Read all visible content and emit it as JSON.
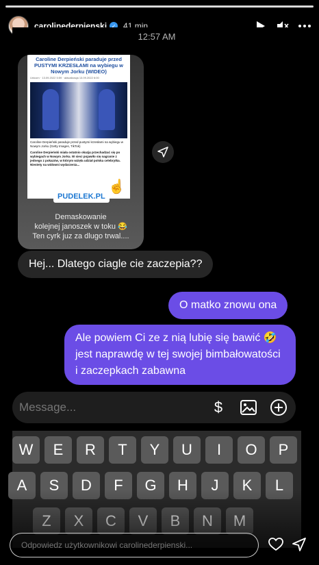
{
  "story": {
    "username": "carolinederpienski",
    "time_ago": "41 min",
    "reply_placeholder": "Odpowiedz użytkownikowi carolinederpienski..."
  },
  "chat": {
    "timestamp": "12:57 AM",
    "shared_post": {
      "title": "Caroline Derpieński paraduje przed PUSTYMI KRZESŁAMI na wybiegu w Nowym Jorku (WIDEO)",
      "meta": "Unicorn · 13.09.2022 5:59 · aktualizacja 13.09.2022 6:00",
      "photo_caption": "Caroline Derpieński paraduje przed pustymi krzesłami na wybiegu w Nowym Jorku (Getty Images, TikTok)",
      "body": "Caroline Derpieński miała ostatnio okazję przechadzać się po wybiegach w Nowym Jorku. W sieci pojawiło się nagranie z jednego z pokazów, w którym wzięła udział polska celebrytka. Niestety na widowni wydarzenia...",
      "logo": "PUDELEK.PL",
      "caption_line1": "Demaskowanie",
      "caption_line2": "kolejnej janoszek w toku 😂",
      "caption_line3": "Ten cyrk juz za dlugo trwal...."
    },
    "messages": [
      {
        "direction": "incoming",
        "text": "Hej... Dlatego ciagle cie zaczepia??"
      },
      {
        "direction": "outgoing",
        "text": "O matko znowu ona"
      },
      {
        "direction": "outgoing",
        "text": "Ale powiem Ci ze z nią lubię się bawić 🤣 jest naprawdę w tej swojej bimbałowatości i zaczepkach zabawna"
      }
    ],
    "composer_placeholder": "Message..."
  },
  "keyboard": {
    "row1": [
      "W",
      "E",
      "R",
      "T",
      "Y",
      "U",
      "I",
      "O",
      "P"
    ],
    "row2": [
      "A",
      "S",
      "D",
      "F",
      "G",
      "H",
      "J",
      "K",
      "L"
    ],
    "row3": [
      "Z",
      "X",
      "C",
      "V",
      "B",
      "N",
      "M"
    ]
  },
  "colors": {
    "outgoing_bubble": "#6b4de6",
    "incoming_bubble": "#262626",
    "verified": "#3897f0"
  }
}
